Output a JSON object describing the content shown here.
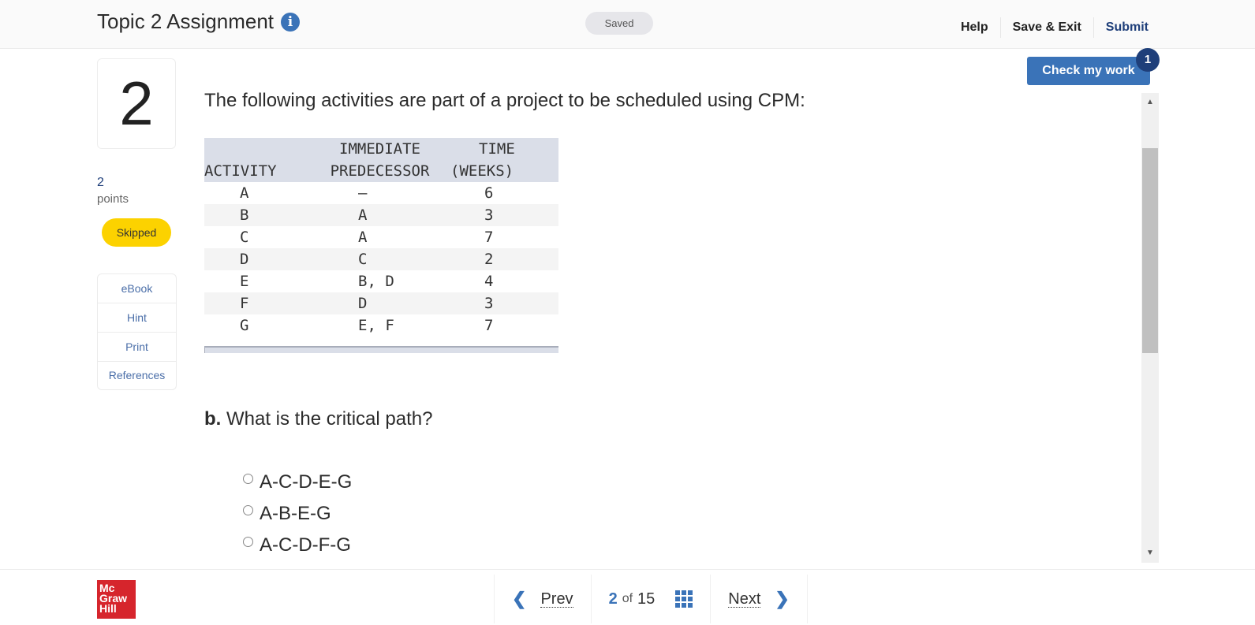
{
  "header": {
    "title": "Topic 2 Assignment",
    "info_icon": "info-icon",
    "saved_status": "Saved",
    "nav": {
      "help": "Help",
      "save_exit": "Save & Exit",
      "submit": "Submit"
    }
  },
  "question": {
    "number": "2",
    "points_value": "2",
    "points_label": "points",
    "status": "Skipped"
  },
  "tools": [
    {
      "label": "eBook"
    },
    {
      "label": "Hint"
    },
    {
      "label": "Print"
    },
    {
      "label": "References"
    }
  ],
  "check_work": {
    "label": "Check my work",
    "badge": "1"
  },
  "content": {
    "prompt": "The following activities are part of a project to be scheduled using CPM:",
    "table": {
      "headers": [
        {
          "line1": "",
          "line2": "ACTIVITY"
        },
        {
          "line1": "IMMEDIATE",
          "line2": "PREDECESSOR"
        },
        {
          "line1": "TIME",
          "line2": "(WEEKS)"
        }
      ],
      "rows": [
        {
          "activity": "A",
          "predecessor": "—",
          "time": "6"
        },
        {
          "activity": "B",
          "predecessor": "A",
          "time": "3"
        },
        {
          "activity": "C",
          "predecessor": "A",
          "time": "7"
        },
        {
          "activity": "D",
          "predecessor": "C",
          "time": "2"
        },
        {
          "activity": "E",
          "predecessor": "B, D",
          "time": "4"
        },
        {
          "activity": "F",
          "predecessor": "D",
          "time": "3"
        },
        {
          "activity": "G",
          "predecessor": "E, F",
          "time": "7"
        }
      ]
    },
    "part_b": {
      "label": "b.",
      "text": "What is the critical path?",
      "options": [
        {
          "label": "A-C-D-E-G"
        },
        {
          "label": "A-B-E-G"
        },
        {
          "label": "A-C-D-F-G"
        }
      ]
    }
  },
  "footer": {
    "logo": {
      "line1": "Mc",
      "line2": "Graw",
      "line3": "Hill"
    },
    "prev": "Prev",
    "next": "Next",
    "current_page": "2",
    "of": "of",
    "total_pages": "15"
  }
}
